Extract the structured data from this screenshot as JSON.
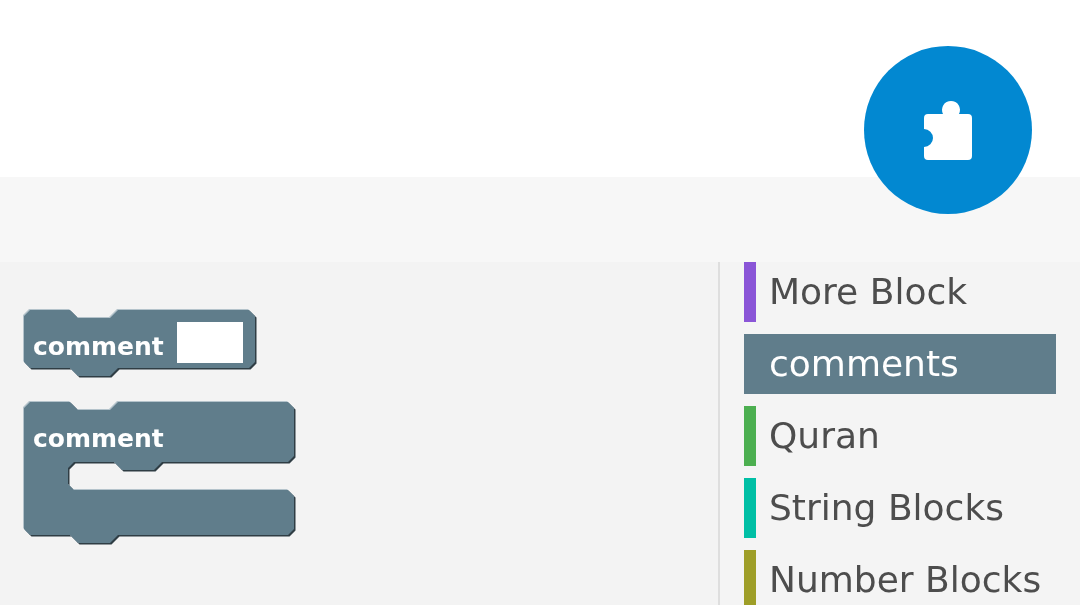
{
  "blocks": [
    {
      "kind": "field",
      "label": "comment"
    },
    {
      "kind": "c_shape",
      "label": "comment"
    }
  ],
  "categories": [
    {
      "label": "More Block",
      "color": "#8a55d7",
      "selected": false
    },
    {
      "label": "comments",
      "color": "#607d8b",
      "selected": true
    },
    {
      "label": "Quran",
      "color": "#4caf50",
      "selected": false
    },
    {
      "label": "String Blocks",
      "color": "#00bfa5",
      "selected": false
    },
    {
      "label": "Number Blocks",
      "color": "#9e9e28",
      "selected": false
    }
  ]
}
